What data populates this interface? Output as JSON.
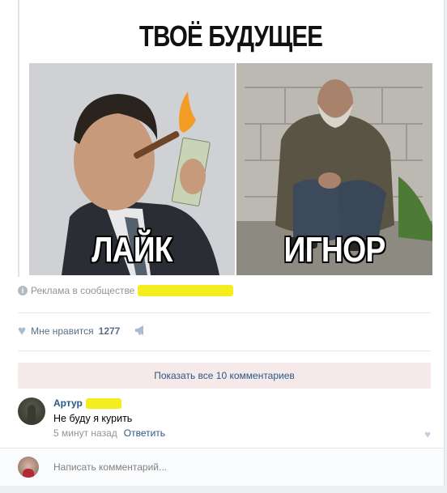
{
  "meme": {
    "caption": "ТВОЁ БУДУЩЕЕ",
    "left_label": "ЛАЙК",
    "right_label": "ИГНОР"
  },
  "ad": {
    "icon": "info-icon",
    "text": "Реклама в сообществе"
  },
  "likes": {
    "label": "Мне нравится",
    "count": "1277",
    "like_icon": "heart-icon",
    "share_icon": "megaphone-icon"
  },
  "comments": {
    "show_all": "Показать все 10 комментариев",
    "items": [
      {
        "author": "Артур",
        "text": "Не буду я курить",
        "time": "5 минут назад",
        "reply": "Ответить"
      }
    ]
  },
  "comment_box": {
    "placeholder": "Написать комментарий..."
  },
  "colors": {
    "link": "#2a5885",
    "highlight": "#f5ee1f",
    "muted": "#939393"
  }
}
